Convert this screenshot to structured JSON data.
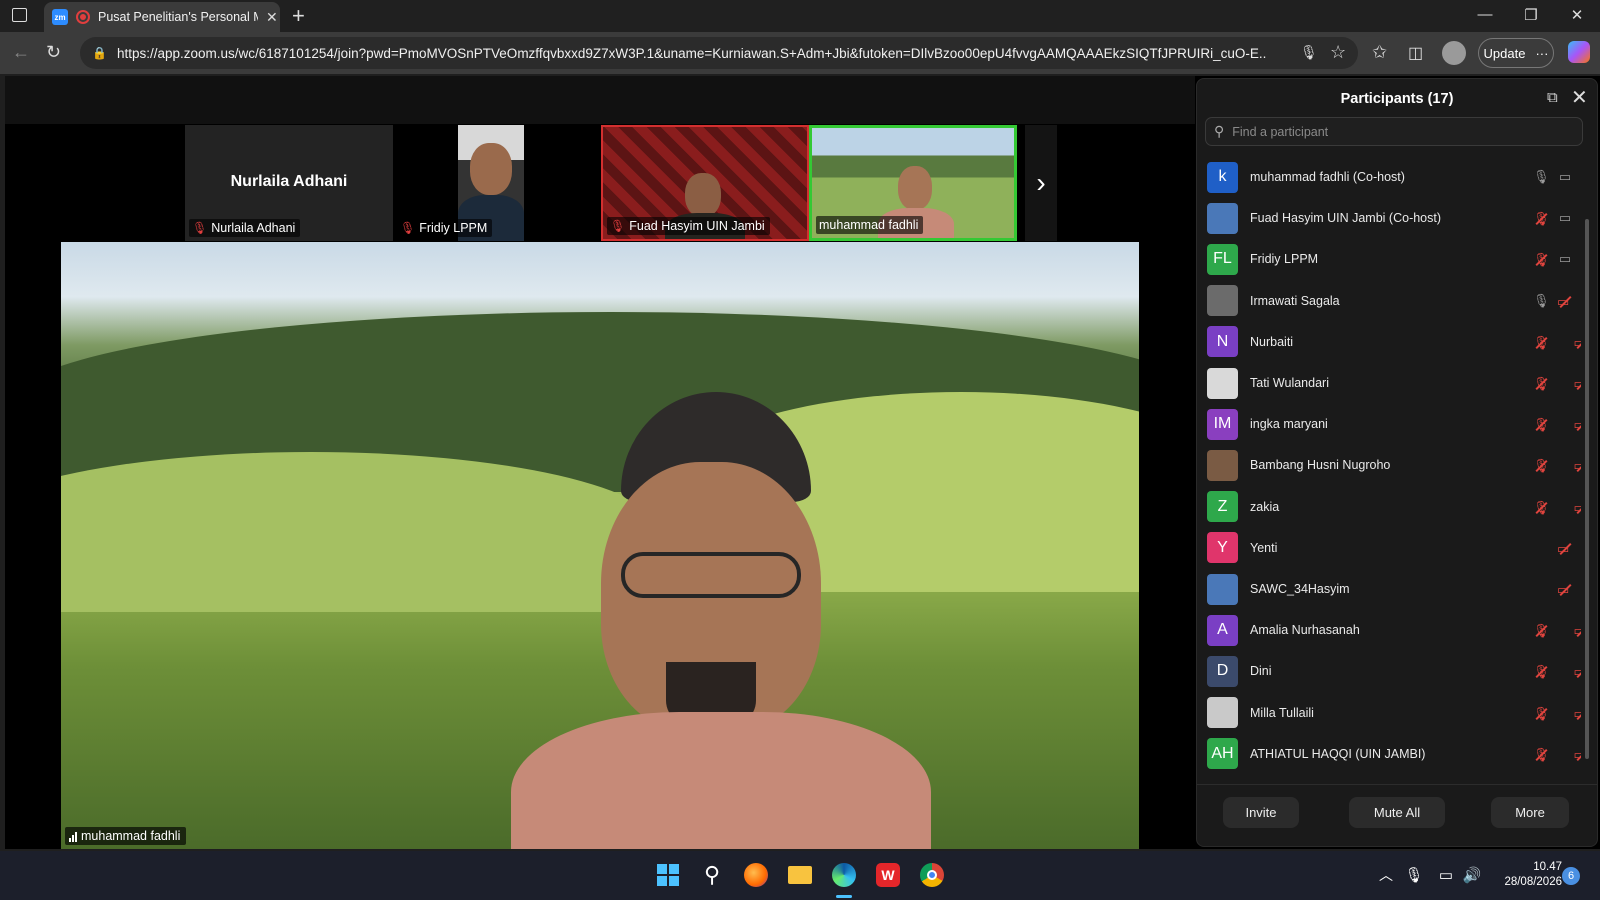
{
  "browser": {
    "tab_title": "Pusat Penelitian's Personal M",
    "url": "https://app.zoom.us/wc/6187101254/join?pwd=PmoMVOSnPTVeOmzffqvbxxd9Z7xW3P.1&uname=Kurniawan.S+Adm+Jbi&futoken=DIlvBzoo00epU4fvvgAAMQAAAEkzSIQTfJPRUIRi_cuO-E...",
    "update_label": "Update",
    "update_more": "···"
  },
  "thumbnails": [
    {
      "name": "Nurlaila Adhani",
      "big_name": "Nurlaila Adhani",
      "muted": true
    },
    {
      "name": "Fridiy LPPM",
      "muted": true
    },
    {
      "name": "Fuad Hasyim UIN Jambi",
      "muted": true
    },
    {
      "name": "muhammad fadhli",
      "muted": false
    }
  ],
  "main_video": {
    "name": "muhammad fadhli"
  },
  "participants_panel": {
    "title": "Participants (17)",
    "search_placeholder": "Find a participant",
    "participants": [
      {
        "name": "muhammad fadhli (Co-host)",
        "initial": "k",
        "avatar_color": "#1f5fc7",
        "mic": "on",
        "cam": "on"
      },
      {
        "name": "Fuad Hasyim UIN Jambi (Co-host)",
        "initial": "",
        "avatar_color": "#4a78b8",
        "mic": "off",
        "cam": "on"
      },
      {
        "name": "Fridiy LPPM",
        "initial": "FL",
        "avatar_color": "#2ea84b",
        "mic": "off",
        "cam": "on"
      },
      {
        "name": "Irmawati Sagala",
        "initial": "",
        "avatar_color": "#6b6b6b",
        "mic": "on",
        "cam": "off"
      },
      {
        "name": "Nurbaiti",
        "initial": "N",
        "avatar_color": "#7a3fc4",
        "mic": "off",
        "cam": "off"
      },
      {
        "name": "Tati Wulandari",
        "initial": "",
        "avatar_color": "#d9d9d9",
        "mic": "off",
        "cam": "off"
      },
      {
        "name": "ingka maryani",
        "initial": "IM",
        "avatar_color": "#8a3fbf",
        "mic": "off",
        "cam": "off"
      },
      {
        "name": "Bambang Husni Nugroho",
        "initial": "",
        "avatar_color": "#7a5b44",
        "mic": "off",
        "cam": "off"
      },
      {
        "name": "zakia",
        "initial": "Z",
        "avatar_color": "#2ea84b",
        "mic": "off",
        "cam": "off"
      },
      {
        "name": "Yenti",
        "initial": "Y",
        "avatar_color": "#e0356b",
        "mic": "none",
        "cam": "off"
      },
      {
        "name": "SAWC_34Hasyim",
        "initial": "",
        "avatar_color": "#4a78b8",
        "mic": "none",
        "cam": "off"
      },
      {
        "name": "Amalia Nurhasanah",
        "initial": "A",
        "avatar_color": "#7a3fc4",
        "mic": "off",
        "cam": "off"
      },
      {
        "name": "Dini",
        "initial": "D",
        "avatar_color": "#3b4a6b",
        "mic": "off",
        "cam": "off"
      },
      {
        "name": "Milla Tullaili",
        "initial": "",
        "avatar_color": "#c9c9c9",
        "mic": "off",
        "cam": "off"
      },
      {
        "name": "ATHIATUL HAQQI (UIN JAMBI)",
        "initial": "AH",
        "avatar_color": "#2ea84b",
        "mic": "off",
        "cam": "off"
      }
    ],
    "buttons": {
      "invite": "Invite",
      "mute_all": "Mute All",
      "more": "More"
    }
  },
  "taskbar": {
    "time": "10.47",
    "date": "28/08/2026",
    "notification_count": "6"
  }
}
